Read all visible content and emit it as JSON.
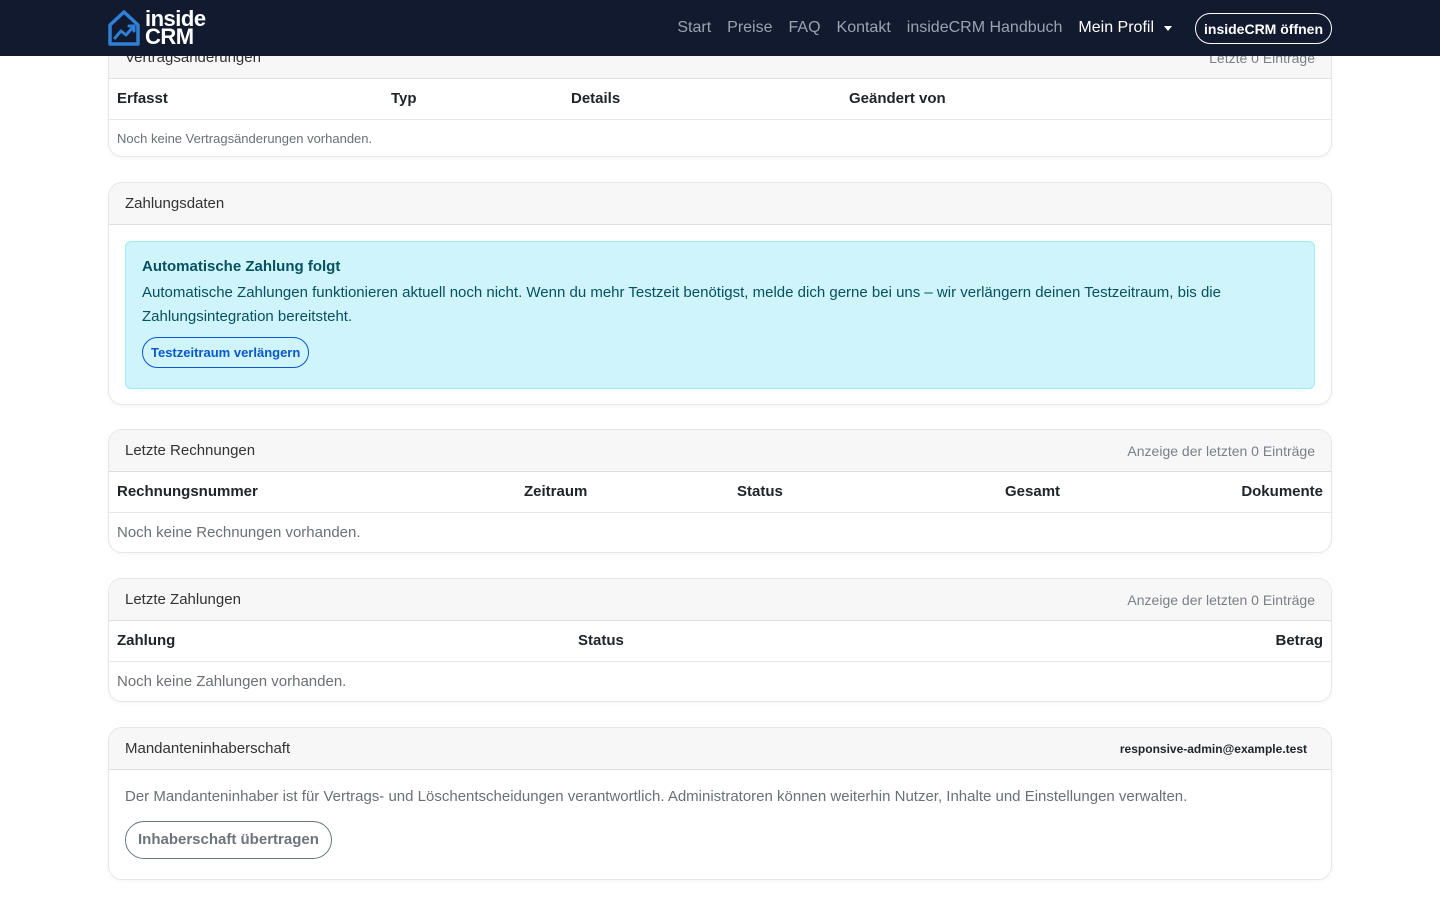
{
  "navbar": {
    "brand_line1": "inside",
    "brand_line2": "CRM",
    "links": [
      "Start",
      "Preise",
      "FAQ",
      "Kontakt",
      "insideCRM Handbuch"
    ],
    "profile_label": "Mein Profil",
    "cta_label": "insideCRM öffnen"
  },
  "vertrag": {
    "title": "Vertragsänderungen",
    "meta": "Letzte 0 Einträge",
    "columns": [
      "Erfasst",
      "Typ",
      "Details",
      "Geändert von"
    ],
    "empty": "Noch keine Vertragsänderungen vorhanden."
  },
  "zahlungsdaten": {
    "title": "Zahlungsdaten",
    "alert_title": "Automatische Zahlung folgt",
    "alert_text": "Automatische Zahlungen funktionieren aktuell noch nicht. Wenn du mehr Testzeit benötigst, melde dich gerne bei uns – wir verlängern deinen Testzeitraum, bis die Zahlungsintegration bereitsteht.",
    "button": "Testzeitraum verlängern"
  },
  "rechnungen": {
    "title": "Letzte Rechnungen",
    "meta": "Anzeige der letzten 0 Einträge",
    "columns": [
      "Rechnungsnummer",
      "Zeitraum",
      "Status",
      "Gesamt",
      "Dokumente"
    ],
    "empty": "Noch keine Rechnungen vorhanden."
  },
  "zahlungen": {
    "title": "Letzte Zahlungen",
    "meta": "Anzeige der letzten 0 Einträge",
    "columns": [
      "Zahlung",
      "Status",
      "Betrag"
    ],
    "empty": "Noch keine Zahlungen vorhanden."
  },
  "mandant": {
    "title": "Mandanteninhaberschaft",
    "email": "responsive-admin@example.test",
    "text": "Der Mandanteninhaber ist für Vertrags- und Löschentscheidungen verantwortlich. Administratoren können weiterhin Nutzer, Inhalte und Einstellungen verwalten.",
    "button": "Inhaberschaft übertragen"
  },
  "colors": {
    "navbar_bg": "#111a2e",
    "alert_bg": "#cff4fc",
    "alert_text": "#055160",
    "primary": "#0a58ca"
  }
}
